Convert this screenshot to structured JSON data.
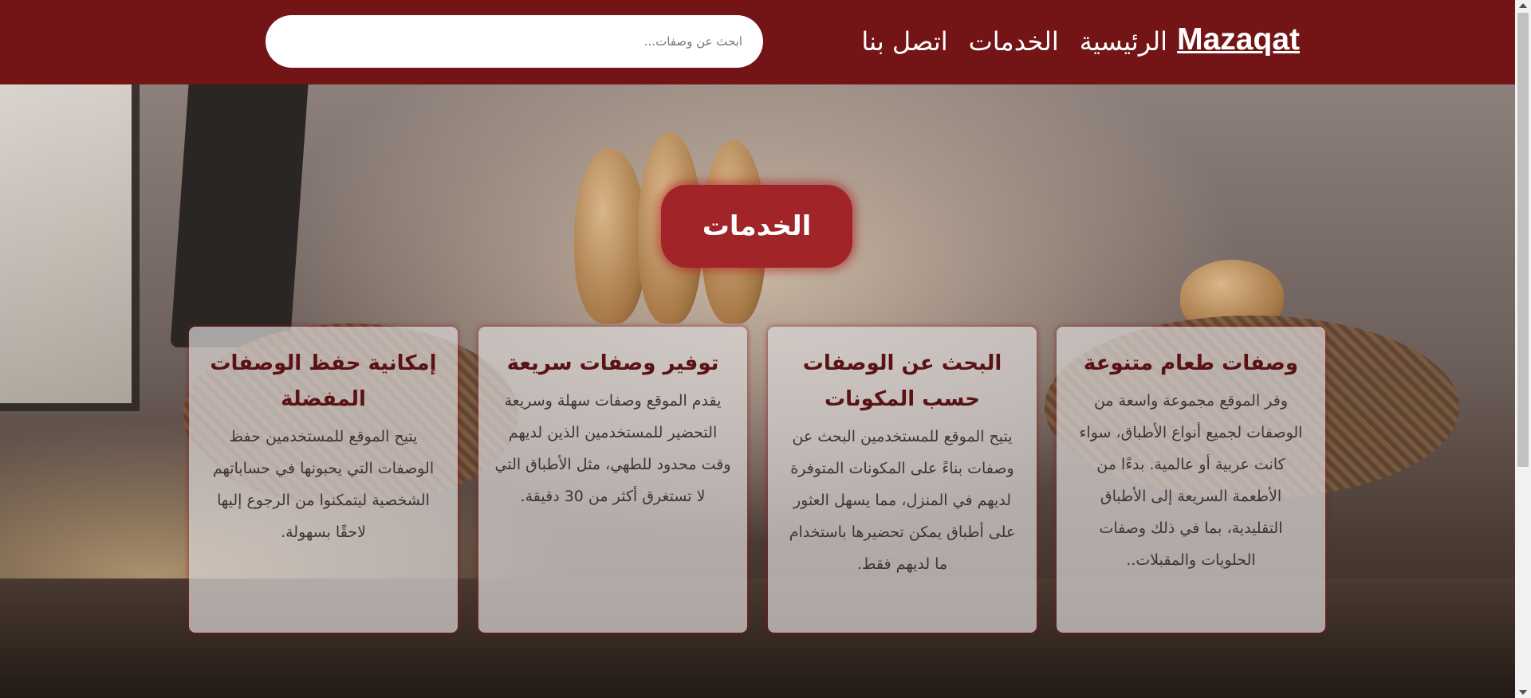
{
  "header": {
    "brand": "Mazaqat",
    "nav": [
      {
        "label": "الرئيسية"
      },
      {
        "label": "الخدمات"
      },
      {
        "label": "اتصل بنا"
      }
    ],
    "search": {
      "placeholder": "ابحث عن وصفات..."
    }
  },
  "hero": {
    "title": "الخدمات",
    "cards": [
      {
        "title": "وصفات طعام متنوعة",
        "text": "وفر الموقع مجموعة واسعة من الوصفات لجميع أنواع الأطباق، سواء كانت عربية أو عالمية. بدءًا من الأطعمة السريعة إلى الأطباق التقليدية، بما في ذلك وصفات الحلويات والمقبلات.."
      },
      {
        "title": "البحث عن الوصفات حسب المكونات",
        "text": "يتيح الموقع للمستخدمين البحث عن وصفات بناءً على المكونات المتوفرة لديهم في المنزل، مما يسهل العثور على أطباق يمكن تحضيرها باستخدام ما لديهم فقط."
      },
      {
        "title": "توفير وصفات سريعة",
        "text": "يقدم الموقع وصفات سهلة وسريعة التحضير للمستخدمين الذين لديهم وقت محدود للطهي، مثل الأطباق التي لا تستغرق أكثر من 30 دقيقة."
      },
      {
        "title": "إمكانية حفظ الوصفات المفضلة",
        "text": "يتيح الموقع للمستخدمين حفظ الوصفات التي يحبونها في حساباتهم الشخصية ليتمكنوا من الرجوع إليها لاحقًا بسهولة."
      }
    ]
  },
  "colors": {
    "header_bg": "#731517",
    "title_pill": "#a02428",
    "card_title": "#5a1214"
  }
}
